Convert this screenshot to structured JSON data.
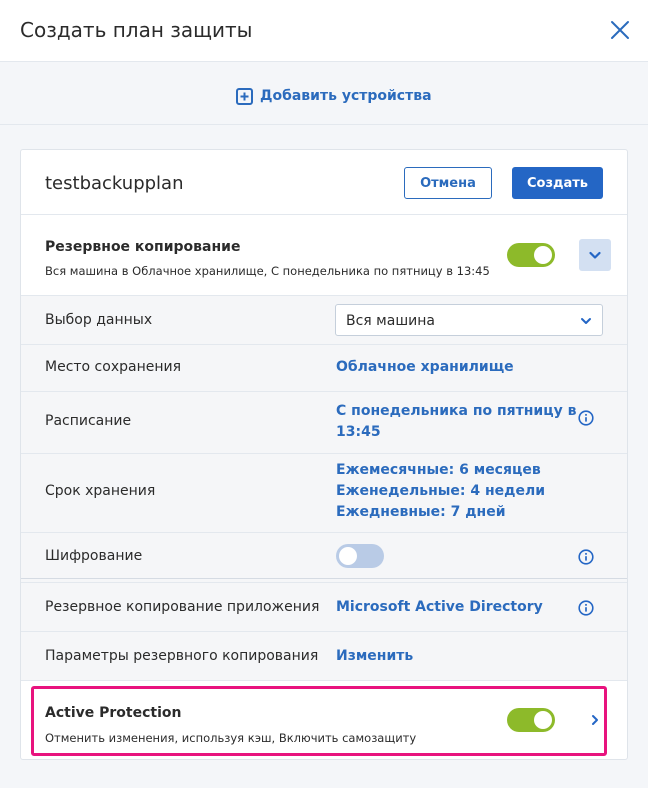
{
  "dialog": {
    "title": "Создать план защиты",
    "add_devices": "Добавить устройства"
  },
  "plan": {
    "name": "testbackupplan",
    "cancel_label": "Отмена",
    "create_label": "Создать"
  },
  "backup": {
    "title": "Резервное копирование",
    "description": "Вся машина в Облачное хранилище, С понедельника по пятницу в 13:45",
    "enabled": true
  },
  "settings": {
    "data_selection": {
      "label": "Выбор данных",
      "value": "Вся машина"
    },
    "destination": {
      "label": "Место сохранения",
      "value": "Облачное хранилище"
    },
    "schedule": {
      "label": "Расписание",
      "value_line1": "С понедельника по пятницу в",
      "value_line2": "13:45"
    },
    "retention": {
      "label": "Срок хранения",
      "monthly": "Ежемесячные: 6 месяцев",
      "weekly": "Еженедельные: 4 недели",
      "daily": "Ежедневные: 7 дней"
    },
    "encryption": {
      "label": "Шифрование",
      "enabled": false
    },
    "app_backup": {
      "label": "Резервное копирование приложения",
      "value": "Microsoft Active Directory"
    },
    "backup_options": {
      "label": "Параметры резервного копирования",
      "value": "Изменить"
    }
  },
  "active_protection": {
    "title": "Active Protection",
    "description": "Отменить изменения, используя кэш, Включить самозащиту",
    "enabled": true
  },
  "colors": {
    "accent": "#2466c5",
    "link": "#2b6bbd",
    "toggle_on": "#8dba2a",
    "toggle_off": "#b9cbe6",
    "highlight": "#e8137e"
  },
  "icons": [
    "close-icon",
    "plus-square-icon",
    "chevron-down-icon",
    "info-icon",
    "chevron-right-icon"
  ]
}
